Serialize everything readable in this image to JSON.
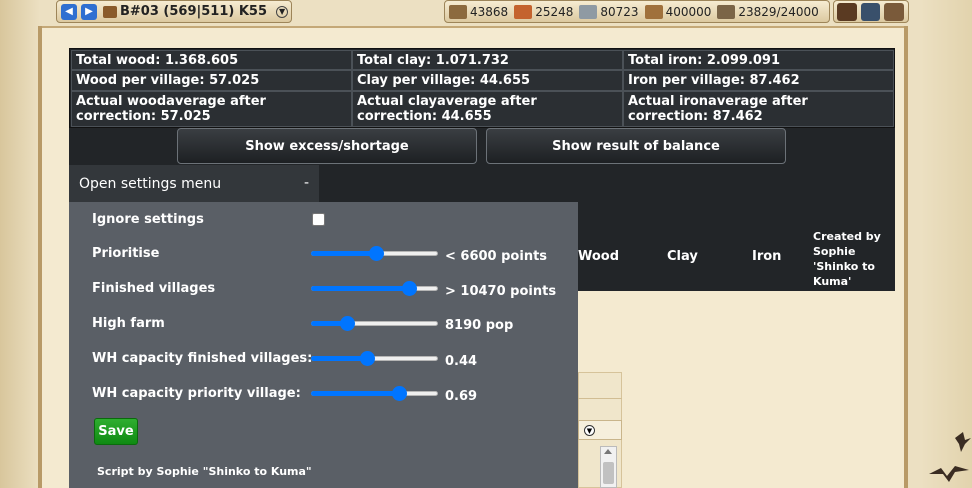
{
  "topbar": {
    "village": "B#03 (569|511) K55",
    "resources": [
      {
        "name": "wood",
        "value": "43868",
        "icon": "wood-icon"
      },
      {
        "name": "clay",
        "value": "25248",
        "icon": "clay-icon"
      },
      {
        "name": "iron",
        "value": "80723",
        "icon": "iron-icon"
      },
      {
        "name": "storage",
        "value": "400000",
        "icon": "storage-icon"
      },
      {
        "name": "population",
        "value": "23829/24000",
        "icon": "population-icon"
      }
    ]
  },
  "stats": {
    "total_wood": "Total wood: 1.368.605",
    "total_clay": "Total clay: 1.071.732",
    "total_iron": "Total iron: 2.099.091",
    "wood_per_village": "Wood per village: 57.025",
    "clay_per_village": "Clay per village: 44.655",
    "iron_per_village": "Iron per village: 87.462",
    "wood_avg": "Actual woodaverage after correction: 57.025",
    "clay_avg": "Actual clayaverage after correction: 44.655",
    "iron_avg": "Actual ironaverage after correction: 87.462"
  },
  "buttons": {
    "excess": "Show excess/shortage",
    "balance": "Show result of balance"
  },
  "settings": {
    "header": "Open settings menu",
    "collapse": "-",
    "ignore_label": "Ignore settings",
    "ignore_checked": false,
    "prioritise_label": "Prioritise",
    "prioritise_value": "< 6600 points",
    "prioritise_level": 0.51,
    "finished_label": "Finished villages",
    "finished_value": "> 10470 points",
    "finished_level": 0.77,
    "highfarm_label": "High farm",
    "highfarm_value": "8190 pop",
    "highfarm_level": 0.28,
    "whfinished_label": "WH capacity finished villages:",
    "whfinished_value": "0.44",
    "whfinished_level": 0.44,
    "whpriority_label": "WH capacity priority village:",
    "whpriority_value": "0.69",
    "whpriority_level": 0.69,
    "save": "Save",
    "credit": "Script by Sophie \"Shinko to Kuma\""
  },
  "columns": {
    "wood": "Wood",
    "clay": "Clay",
    "iron": "Iron",
    "created_by": "Created by Sophie 'Shinko to Kuma'"
  },
  "colors": {
    "accent": "#0075ff",
    "save": "#1a9a1c",
    "panel": "#5a5f66",
    "dark": "#202326"
  }
}
